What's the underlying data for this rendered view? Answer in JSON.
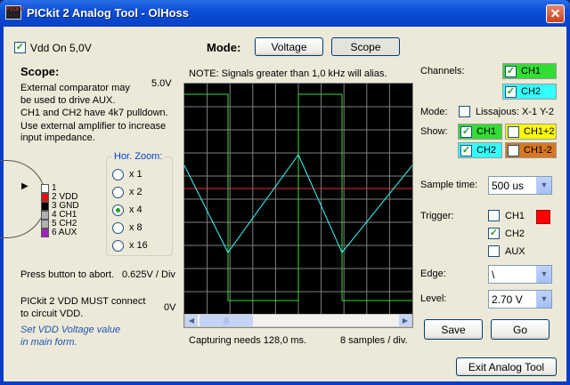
{
  "window": {
    "title": "PICkit 2 Analog Tool - OlHoss",
    "icon_text": "PICkit",
    "close_glyph": "✕"
  },
  "left": {
    "vdd_on_label": "Vdd On 5,0V",
    "scope_heading": "Scope:",
    "scope_voltage": "5.0V",
    "scope_text_1": "External comparator may",
    "scope_text_2": "be used to drive AUX.",
    "scope_text_3": "CH1 and CH2 have 4k7 pulldown.",
    "scope_text_4": "Use external amplifier to increase",
    "scope_text_5": "input impedance.",
    "pins": [
      {
        "num": "1",
        "name": "",
        "color": "#ffffff"
      },
      {
        "num": "2",
        "name": "VDD",
        "color": "#e01010"
      },
      {
        "num": "3",
        "name": "GND",
        "color": "#000000"
      },
      {
        "num": "4",
        "name": "CH1",
        "color": "#b0b0b0"
      },
      {
        "num": "5",
        "name": "CH2",
        "color": "#b0b0b0"
      },
      {
        "num": "6",
        "name": "AUX",
        "color": "#a020c0"
      }
    ],
    "hor_zoom_label": "Hor. Zoom:",
    "zoom_options": [
      "x 1",
      "x 2",
      "x 4",
      "x 8",
      "x 16"
    ],
    "zoom_selected": "x 4",
    "abort_text": "Press button to abort.",
    "volts_per_div": "0.625V / Div",
    "vdd_warn_1": "PICkit 2 VDD MUST connect",
    "vdd_warn_2": "to circuit VDD.",
    "vdd_value": "0V",
    "set_vdd_1": "Set VDD Voltage value",
    "set_vdd_2": "in main form."
  },
  "mode": {
    "label": "Mode:",
    "voltage_label": "Voltage",
    "scope_label": "Scope"
  },
  "scope": {
    "note": "NOTE: Signals greater than 1,0 kHz will alias.",
    "capture_text": "Capturing needs 128,0 ms.",
    "samples_text": "8 samples / div.",
    "scroll_left": "◀",
    "scroll_right": "▶",
    "scroll_grip": "|||"
  },
  "right": {
    "channels_label": "Channels:",
    "ch1_label": "CH1",
    "ch2_label": "CH2",
    "mode_label": "Mode:",
    "lissajous_label": "Lissajous: X-1 Y-2",
    "show_label": "Show:",
    "show_ch1": "CH1",
    "show_ch1p2": "CH1+2",
    "show_ch2": "CH2",
    "show_ch1m2": "CH1-2",
    "sample_time_label": "Sample time:",
    "sample_time_value": "500 us",
    "trigger_label": "Trigger:",
    "trig_ch1": "CH1",
    "trig_ch2": "CH2",
    "trig_aux": "AUX",
    "edge_label": "Edge:",
    "edge_value": "\\",
    "level_label": "Level:",
    "level_value": "2.70 V",
    "save_label": "Save",
    "go_label": "Go",
    "exit_label": "Exit Analog Tool"
  },
  "colors": {
    "ch1": "#33dd33",
    "ch2": "#33ffff",
    "ch1p2": "#ffff00",
    "ch1m2": "#d87820",
    "trigger": "#ff0000",
    "grid": "#808080",
    "trigger_line": "#e03030"
  },
  "icons": {
    "check": "✓",
    "arrow_down": "▼",
    "pointer": "▶"
  }
}
